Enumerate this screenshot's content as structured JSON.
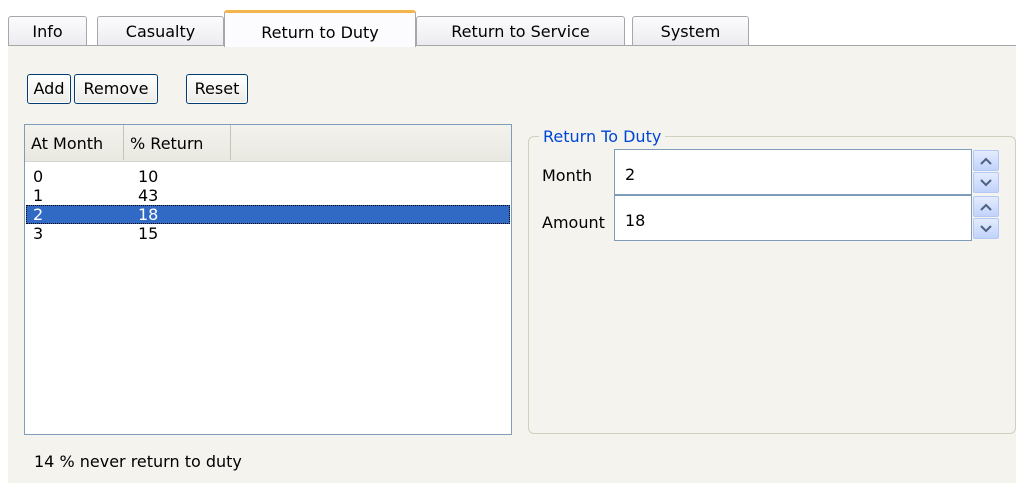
{
  "tabs": [
    {
      "label": "Info"
    },
    {
      "label": "Casualty"
    },
    {
      "label": "Return to Duty",
      "active": true
    },
    {
      "label": "Return to Service"
    },
    {
      "label": "System"
    }
  ],
  "toolbar": {
    "add_label": "Add",
    "remove_label": "Remove",
    "reset_label": "Reset"
  },
  "list": {
    "columns": [
      "At Month",
      "% Return"
    ],
    "rows": [
      {
        "month": "0",
        "return": "10"
      },
      {
        "month": "1",
        "return": "43"
      },
      {
        "month": "2",
        "return": "18",
        "selected": true
      },
      {
        "month": "3",
        "return": "15"
      }
    ]
  },
  "group": {
    "title": "Return To Duty",
    "month_label": "Month",
    "month_value": "2",
    "amount_label": "Amount",
    "amount_value": "18"
  },
  "status_text": "14 % never return to duty",
  "colors": {
    "accent": "#316ac5",
    "tab_highlight": "#f3b54b",
    "group_title": "#0046d5"
  }
}
